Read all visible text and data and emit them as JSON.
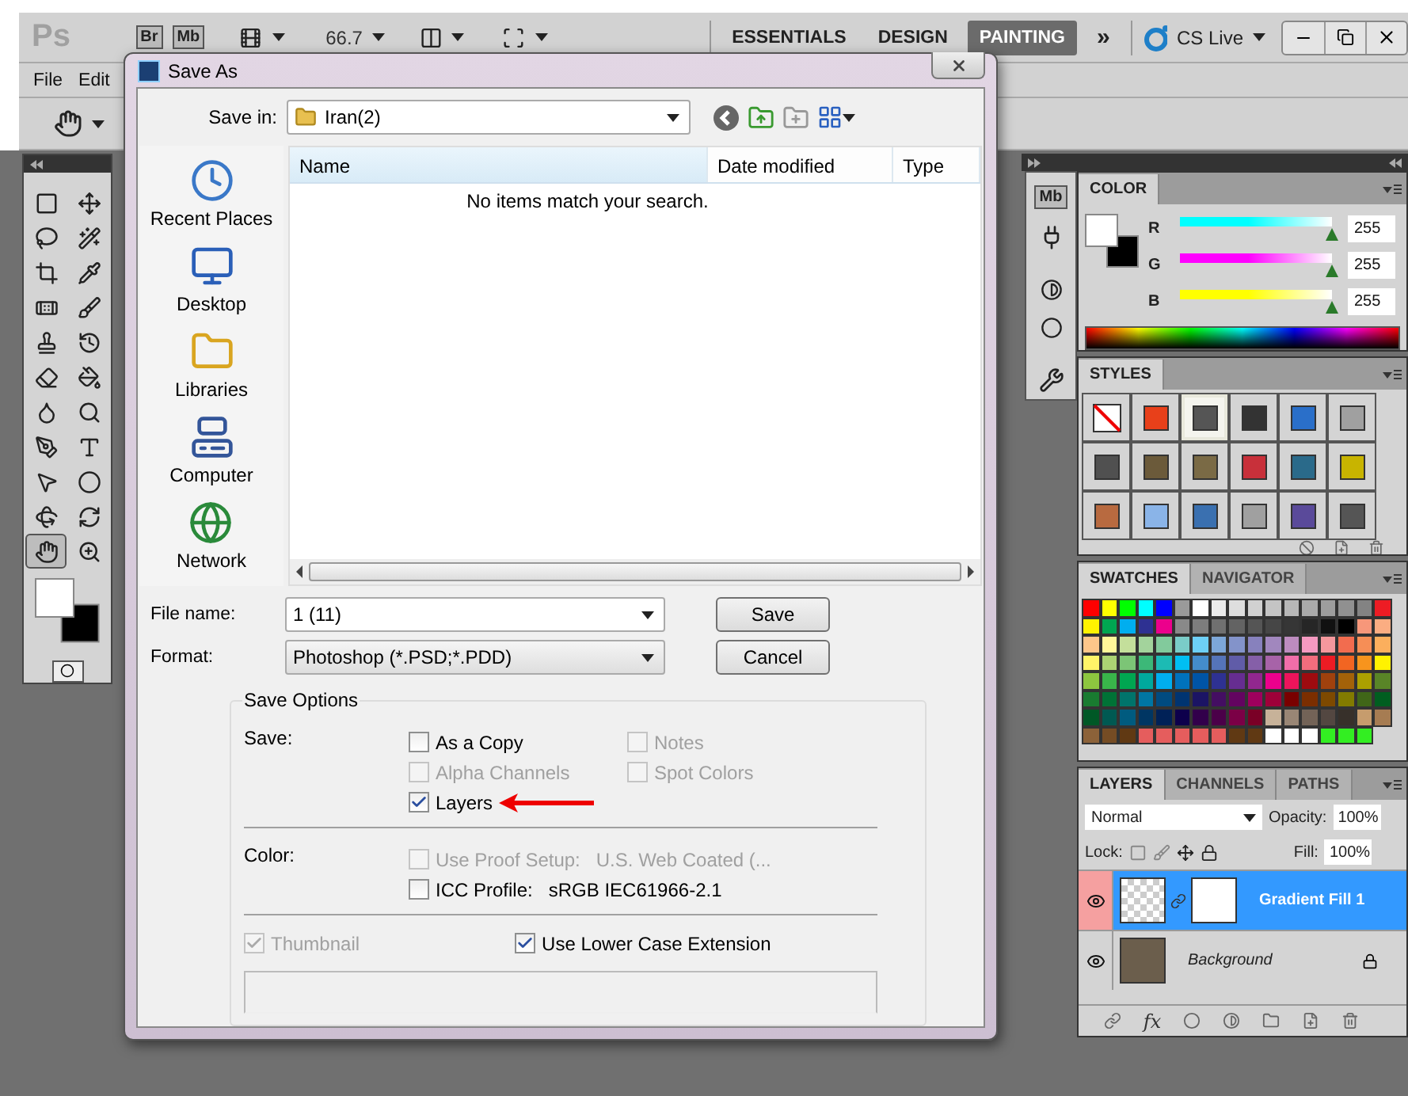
{
  "app": {
    "logo": "Ps",
    "bridge": "Br",
    "mini_bridge": "Mb",
    "zoom": "66.7",
    "workspaces": [
      {
        "label": "ESSENTIALS",
        "selected": false
      },
      {
        "label": "DESIGN",
        "selected": false
      },
      {
        "label": "PAINTING",
        "selected": true
      }
    ],
    "more": "»",
    "cs_live": "CS Live"
  },
  "menu": [
    "File",
    "Edit"
  ],
  "toolbox": {
    "tools": [
      {
        "selected": false
      },
      {
        "selected": false
      },
      {
        "selected": false
      },
      {
        "selected": false
      },
      {
        "selected": false
      },
      {
        "selected": false
      },
      {
        "selected": false
      },
      {
        "selected": false
      },
      {
        "selected": false
      },
      {
        "selected": false
      },
      {
        "selected": false
      },
      {
        "selected": false
      },
      {
        "selected": false
      },
      {
        "selected": false
      },
      {
        "selected": false
      },
      {
        "selected": false
      },
      {
        "selected": false
      },
      {
        "selected": false
      },
      {
        "selected": false
      },
      {
        "selected": false
      },
      {
        "selected": true
      },
      {
        "selected": false
      }
    ]
  },
  "dialog": {
    "title": "Save As",
    "save_in_label": "Save in:",
    "save_in_value": "Iran(2)",
    "places": [
      "Recent Places",
      "Desktop",
      "Libraries",
      "Computer",
      "Network"
    ],
    "columns": [
      "Name",
      "Date modified",
      "Type"
    ],
    "empty_message": "No items match your search.",
    "file_name_label": "File name:",
    "file_name": "1 (11)",
    "format_label": "Format:",
    "format": "Photoshop (*.PSD;*.PDD)",
    "buttons": [
      "Save",
      "Cancel"
    ],
    "save_options": {
      "legend": "Save Options",
      "save_label": "Save:",
      "save_checks": [
        {
          "label": "As a Copy",
          "checked": false,
          "disabled": false,
          "arrow": false
        },
        {
          "label": "Alpha Channels",
          "checked": false,
          "disabled": true,
          "arrow": false
        },
        {
          "label": "Layers",
          "checked": true,
          "disabled": false,
          "arrow": true
        },
        {
          "label": "Notes",
          "checked": false,
          "disabled": true,
          "arrow": false
        },
        {
          "label": "Spot Colors",
          "checked": false,
          "disabled": true,
          "arrow": false
        }
      ],
      "color_label": "Color:",
      "color_checks": [
        {
          "label": "Use Proof Setup:",
          "value": "U.S. Web Coated (...",
          "checked": false,
          "disabled": true
        },
        {
          "label": "ICC Profile:",
          "value": "sRGB IEC61966-2.1",
          "checked": false,
          "disabled": false
        }
      ],
      "bottom_checks": [
        {
          "label": "Thumbnail",
          "checked": true,
          "disabled": true
        },
        {
          "label": "Use Lower Case Extension",
          "checked": true,
          "disabled": false
        }
      ]
    }
  },
  "icon_strip": {
    "mini_bridge": "Mb"
  },
  "color_panel": {
    "tab": "COLOR",
    "channels": [
      {
        "name": "R",
        "color": "#00ffff",
        "level": 1,
        "reading": "255"
      },
      {
        "name": "G",
        "color": "#ff00ff",
        "level": 1,
        "reading": "255"
      },
      {
        "name": "B",
        "color": "#ffff00",
        "level": 1,
        "reading": "255"
      }
    ]
  },
  "styles_panel": {
    "tab": "STYLES",
    "styles": [
      {
        "kind": "none",
        "color": "#ffffff",
        "selected": false
      },
      {
        "kind": "fill",
        "color": "#e8401a",
        "selected": false
      },
      {
        "kind": "fill",
        "color": "#555555",
        "selected": true
      },
      {
        "kind": "fill",
        "color": "#333333",
        "selected": false
      },
      {
        "kind": "fill",
        "color": "#2a6fc9",
        "selected": false
      },
      {
        "kind": "fill",
        "color": "#a0a0a0",
        "selected": false
      },
      {
        "kind": "fill",
        "color": "#505050",
        "selected": false
      },
      {
        "kind": "fill",
        "color": "#6b5a3a",
        "selected": false
      },
      {
        "kind": "fill",
        "color": "#7a6a45",
        "selected": false
      },
      {
        "kind": "fill",
        "color": "#c8303a",
        "selected": false
      },
      {
        "kind": "fill",
        "color": "#2a6a8a",
        "selected": false
      },
      {
        "kind": "fill",
        "color": "#c8b400",
        "selected": false
      },
      {
        "kind": "fill",
        "color": "#b86a40",
        "selected": false
      },
      {
        "kind": "fill",
        "color": "#8ab4e8",
        "selected": false
      },
      {
        "kind": "fill",
        "color": "#3a70b0",
        "selected": false
      },
      {
        "kind": "fill",
        "color": "#a0a0a0",
        "selected": false
      },
      {
        "kind": "fill",
        "color": "#5a4a9a",
        "selected": false
      },
      {
        "kind": "fill",
        "color": "#555555",
        "selected": false
      }
    ]
  },
  "swatches_panel": {
    "tabs": [
      {
        "label": "SWATCHES",
        "selected": true
      },
      {
        "label": "NAVIGATOR",
        "selected": false
      }
    ],
    "swatches": [
      {
        "color": "#ff0000"
      },
      {
        "color": "#ffff00"
      },
      {
        "color": "#00ff00"
      },
      {
        "color": "#00ffff"
      },
      {
        "color": "#0000ff"
      },
      {
        "color": "#9a9a9a"
      },
      {
        "color": "#ffffff"
      },
      {
        "color": "#ebebeb"
      },
      {
        "color": "#dedede"
      },
      {
        "color": "#d1d1d1"
      },
      {
        "color": "#c4c4c4"
      },
      {
        "color": "#b7b7b7"
      },
      {
        "color": "#aaaaaa"
      },
      {
        "color": "#9d9d9d"
      },
      {
        "color": "#909090"
      },
      {
        "color": "#838383"
      },
      {
        "color": "#ed1c24"
      },
      {
        "color": "#fff200"
      },
      {
        "color": "#00a651"
      },
      {
        "color": "#00aeef"
      },
      {
        "color": "#2e3192"
      },
      {
        "color": "#ec008c"
      },
      {
        "color": "#898989"
      },
      {
        "color": "#7d7d7d"
      },
      {
        "color": "#707070"
      },
      {
        "color": "#636363"
      },
      {
        "color": "#555555"
      },
      {
        "color": "#464646"
      },
      {
        "color": "#363636"
      },
      {
        "color": "#262626"
      },
      {
        "color": "#111111"
      },
      {
        "color": "#000000"
      },
      {
        "color": "#f7977a"
      },
      {
        "color": "#fbad82"
      },
      {
        "color": "#fdc68a"
      },
      {
        "color": "#fff799"
      },
      {
        "color": "#c4df9b"
      },
      {
        "color": "#a3d39c"
      },
      {
        "color": "#82ca9c"
      },
      {
        "color": "#7accc8"
      },
      {
        "color": "#6dcff6"
      },
      {
        "color": "#7da7d9"
      },
      {
        "color": "#8393ca"
      },
      {
        "color": "#8781bd"
      },
      {
        "color": "#a187be"
      },
      {
        "color": "#bd8cbf"
      },
      {
        "color": "#f49ac1"
      },
      {
        "color": "#f5989d"
      },
      {
        "color": "#f26c4f"
      },
      {
        "color": "#f68e56"
      },
      {
        "color": "#fbaf5d"
      },
      {
        "color": "#fff468"
      },
      {
        "color": "#acd373"
      },
      {
        "color": "#7cc576"
      },
      {
        "color": "#3cb878"
      },
      {
        "color": "#1cbbb4"
      },
      {
        "color": "#00bff3"
      },
      {
        "color": "#448ccb"
      },
      {
        "color": "#5574b9"
      },
      {
        "color": "#605ca8"
      },
      {
        "color": "#855fa8"
      },
      {
        "color": "#a763a8"
      },
      {
        "color": "#f06ea9"
      },
      {
        "color": "#f26d7d"
      },
      {
        "color": "#ed1c24"
      },
      {
        "color": "#f26522"
      },
      {
        "color": "#f7941d"
      },
      {
        "color": "#fff200"
      },
      {
        "color": "#8dc63f"
      },
      {
        "color": "#39b54a"
      },
      {
        "color": "#00a651"
      },
      {
        "color": "#00a99d"
      },
      {
        "color": "#00aeef"
      },
      {
        "color": "#0072bc"
      },
      {
        "color": "#0054a6"
      },
      {
        "color": "#2e3192"
      },
      {
        "color": "#662d91"
      },
      {
        "color": "#92278f"
      },
      {
        "color": "#ec008c"
      },
      {
        "color": "#ed145b"
      },
      {
        "color": "#9e0b0f"
      },
      {
        "color": "#a0410d"
      },
      {
        "color": "#a36209"
      },
      {
        "color": "#aba000"
      },
      {
        "color": "#598527"
      },
      {
        "color": "#197b30"
      },
      {
        "color": "#007236"
      },
      {
        "color": "#00746b"
      },
      {
        "color": "#0076a3"
      },
      {
        "color": "#004b80"
      },
      {
        "color": "#003471"
      },
      {
        "color": "#1b1464"
      },
      {
        "color": "#440e62"
      },
      {
        "color": "#630460"
      },
      {
        "color": "#9e005d"
      },
      {
        "color": "#9e0039"
      },
      {
        "color": "#790000"
      },
      {
        "color": "#7b2e00"
      },
      {
        "color": "#7d4900"
      },
      {
        "color": "#827b00"
      },
      {
        "color": "#406618"
      },
      {
        "color": "#005e20"
      },
      {
        "color": "#005826"
      },
      {
        "color": "#005952"
      },
      {
        "color": "#005b7f"
      },
      {
        "color": "#003663"
      },
      {
        "color": "#002157"
      },
      {
        "color": "#0d004c"
      },
      {
        "color": "#32004b"
      },
      {
        "color": "#4b0049"
      },
      {
        "color": "#7b0046"
      },
      {
        "color": "#7a0026"
      },
      {
        "color": "#c7b299"
      },
      {
        "color": "#998675"
      },
      {
        "color": "#736357"
      },
      {
        "color": "#534741"
      },
      {
        "color": "#37302a"
      },
      {
        "color": "#c69c6d"
      },
      {
        "color": "#a67c52"
      },
      {
        "color": "#8c6239"
      },
      {
        "color": "#754c24"
      },
      {
        "color": "#603913"
      },
      {
        "color": "#e55d5d"
      },
      {
        "color": "#e55d5d"
      },
      {
        "color": "#e55d5d"
      },
      {
        "color": "#e55d5d"
      },
      {
        "color": "#e55d5d"
      },
      {
        "color": "#603913"
      },
      {
        "color": "#603913"
      },
      {
        "color": "#ffffff"
      },
      {
        "color": "#ffffff"
      },
      {
        "color": "#ffffff"
      },
      {
        "color": "#33ee22"
      },
      {
        "color": "#33ee22"
      },
      {
        "color": "#33ee22"
      }
    ]
  },
  "layers_panel": {
    "tabs": [
      {
        "label": "LAYERS",
        "selected": true
      },
      {
        "label": "CHANNELS",
        "selected": false
      },
      {
        "label": "PATHS",
        "selected": false
      }
    ],
    "blend_mode": "Normal",
    "opacity_label": "Opacity:",
    "opacity": "100%",
    "lock_label": "Lock:",
    "fill_label": "Fill:",
    "fill": "100%",
    "footer_fx": "fx",
    "layers": [
      {
        "name": "Gradient Fill 1",
        "kind": "fill",
        "selected": true,
        "visible": true,
        "locked": false
      },
      {
        "name": "Background",
        "kind": "background",
        "selected": false,
        "visible": true,
        "locked": true
      }
    ]
  }
}
